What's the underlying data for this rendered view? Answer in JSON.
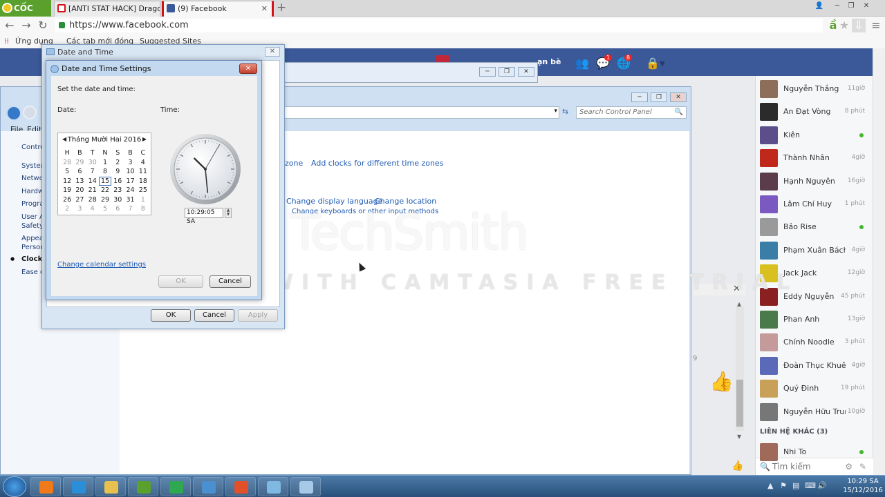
{
  "browser": {
    "brand": "CỐC CỐC",
    "tabs": [
      {
        "title": "[ANTI STAT HACK] Dragon",
        "favicon_color": "#d3101a"
      },
      {
        "title": "(9) Facebook",
        "favicon_color": "#3b5998"
      }
    ],
    "url": "https://www.facebook.com",
    "bookmarks": [
      "Ứng dụng",
      "Các tab mới đóng",
      "Suggested Sites"
    ]
  },
  "facebook": {
    "nav_friends": "ạn bè",
    "notif_counts": [
      "1",
      "8"
    ],
    "contacts": [
      {
        "name": "Nguyễn Thắng",
        "status": "11giờ",
        "color": "#8c6e5a"
      },
      {
        "name": "An Đạt Vòng",
        "status": "8 phút",
        "color": "#2b2b2b"
      },
      {
        "name": "Kiên",
        "status": "online",
        "color": "#5b4e8a"
      },
      {
        "name": "Thành Nhân",
        "status": "4giờ",
        "color": "#c0281c"
      },
      {
        "name": "Hạnh Nguyên",
        "status": "16giờ",
        "color": "#5a3c4a"
      },
      {
        "name": "Lâm Chí Huy",
        "status": "1 phút",
        "color": "#7a5ac0"
      },
      {
        "name": "Bảo Rise",
        "status": "online",
        "color": "#9a9a9a"
      },
      {
        "name": "Phạm Xuân Bách",
        "status": "4giờ",
        "color": "#3a7ea8"
      },
      {
        "name": "Jack Jack",
        "status": "12giờ",
        "color": "#d8c020"
      },
      {
        "name": "Eddy Nguyễn",
        "status": "45 phút",
        "color": "#8a2020"
      },
      {
        "name": "Phan Anh",
        "status": "13giờ",
        "color": "#4a7a4a"
      },
      {
        "name": "Chính Noodle",
        "status": "3 phút",
        "color": "#c49a9a"
      },
      {
        "name": "Đoàn Thục Khuê",
        "status": "4giờ",
        "color": "#5a6ab8"
      },
      {
        "name": "Quý Đinh",
        "status": "19 phút",
        "color": "#c8a058"
      },
      {
        "name": "Nguyễn Hữu Trun...",
        "status": "10giờ",
        "color": "#777777"
      }
    ],
    "other_contacts_header": "LIÊN HỆ KHÁC (3)",
    "other_contacts": [
      {
        "name": "Nhi To",
        "status": "online",
        "color": "#a06a5a"
      }
    ],
    "search_placeholder": "Tìm kiếm"
  },
  "control_panel": {
    "search_placeholder": "Search Control Panel",
    "menu": [
      "File",
      "Edit"
    ],
    "nav_items": [
      "Contro",
      "System",
      "Netwo",
      "Hardw",
      "Progra",
      "User A",
      "Safety",
      "Appea",
      "Person",
      "Clock,",
      "Ease o"
    ],
    "links": [
      "zone",
      "Add clocks for different time zones",
      "Change display language",
      "Change location",
      "Change keyboards or other input methods"
    ],
    "chat_count": "9"
  },
  "watermark": {
    "logo": "TechSmith",
    "text": "MADE WITH CAMTASIA FREE TRIAL"
  },
  "date_time_dialog": {
    "title": "Date and Time",
    "buttons": {
      "ok": "OK",
      "cancel": "Cancel",
      "apply": "Apply"
    }
  },
  "date_time_settings": {
    "title": "Date and Time Settings",
    "instruction": "Set the date and time:",
    "date_label": "Date:",
    "time_label": "Time:",
    "calendar": {
      "month_label": "Tháng Mười Hai 2016",
      "weekdays": [
        "H",
        "B",
        "T",
        "N",
        "S",
        "B",
        "C"
      ],
      "weeks": [
        [
          "28",
          "29",
          "30",
          "1",
          "2",
          "3",
          "4"
        ],
        [
          "5",
          "6",
          "7",
          "8",
          "9",
          "10",
          "11"
        ],
        [
          "12",
          "13",
          "14",
          "15",
          "16",
          "17",
          "18"
        ],
        [
          "19",
          "20",
          "21",
          "22",
          "23",
          "24",
          "25"
        ],
        [
          "26",
          "27",
          "28",
          "29",
          "30",
          "31",
          "1"
        ],
        [
          "2",
          "3",
          "4",
          "5",
          "6",
          "7",
          "8"
        ]
      ],
      "selected_day": "15"
    },
    "time_value": "10:29:05 SA",
    "calendar_link": "Change calendar settings",
    "buttons": {
      "ok": "OK",
      "cancel": "Cancel"
    }
  },
  "taskbar": {
    "time": "10:29 SA",
    "date": "15/12/2016",
    "apps": [
      {
        "name": "media-player",
        "color": "#f07a1a"
      },
      {
        "name": "internet-explorer",
        "color": "#2a8fd8"
      },
      {
        "name": "file-explorer",
        "color": "#e8c050"
      },
      {
        "name": "coccoc-browser",
        "color": "#5aa02c"
      },
      {
        "name": "camtasia-recorder",
        "color": "#2fa84f"
      },
      {
        "name": "control-panel",
        "color": "#4a90d0"
      },
      {
        "name": "camtasia-studio",
        "color": "#e2502a"
      },
      {
        "name": "notepad",
        "color": "#7fb8e0"
      },
      {
        "name": "date-time",
        "color": "#a8c8e8"
      }
    ]
  }
}
